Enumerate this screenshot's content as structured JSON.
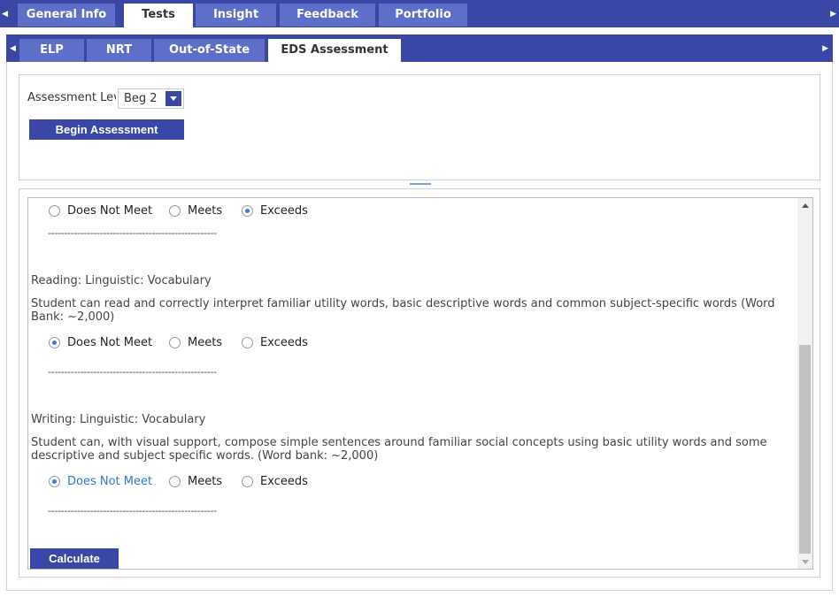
{
  "top_tabs": [
    "General Info",
    "Tests",
    "Insight",
    "Feedback",
    "Portfolio"
  ],
  "sub_tabs": [
    "ELP",
    "NRT",
    "Out-of-State",
    "EDS Assessment"
  ],
  "assessment": {
    "level_label": "Assessment Level",
    "level_value": "Beg 2",
    "begin_label": "Begin Assessment"
  },
  "radio_options": [
    "Does Not Meet",
    "Meets",
    "Exceeds"
  ],
  "divider": "----------------------------------------------------",
  "sections": [
    {
      "selected": "Exceeds"
    },
    {
      "heading": "Reading: Linguistic: Vocabulary",
      "description": "Student can read and correctly interpret familiar utility words, basic descriptive words and common subject-specific words (Word Bank: ~2,000)",
      "selected": "Does Not Meet"
    },
    {
      "heading": "Writing: Linguistic: Vocabulary",
      "description": "Student can, with visual support, compose simple sentences around familiar social concepts using basic utility words and some descriptive and subject specific words. (Word bank: ~2,000)",
      "selected": "Does Not Meet"
    }
  ],
  "calculate_label": "Calculate",
  "colors": {
    "tab_bar": "#3a47a6",
    "tab": "#5f6fc9",
    "highlight": "#2a7ac9"
  }
}
